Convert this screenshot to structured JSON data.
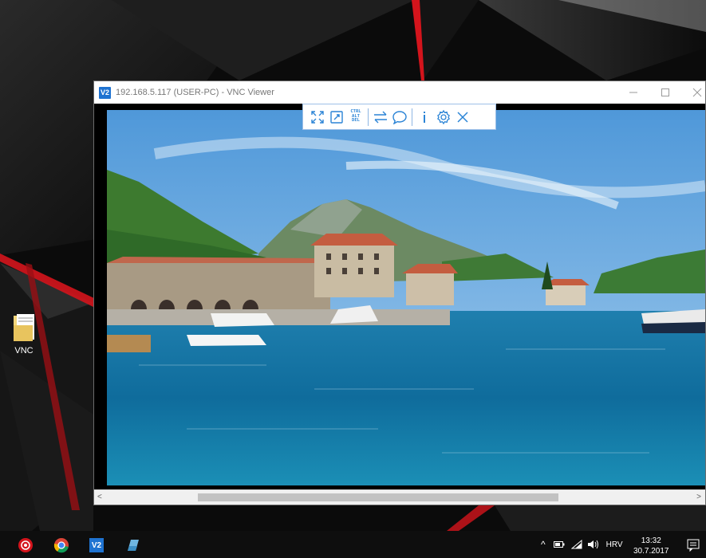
{
  "desktop": {
    "icons": [
      {
        "label": "VNC",
        "icon": "folder-icon"
      }
    ]
  },
  "vnc_window": {
    "title": "192.168.5.117 (USER-PC) - VNC Viewer",
    "app_icon_text": "V2",
    "controls": [
      "minimize-icon",
      "maximize-icon",
      "close-icon"
    ],
    "toolbar": {
      "buttons": [
        "fullscreen-icon",
        "scale-icon",
        "ctrl-alt-del-icon",
        "transfer-icon",
        "chat-icon",
        "info-icon",
        "settings-icon",
        "close-icon"
      ],
      "ctrl_alt_del": [
        "CTRL",
        "ALT",
        "DEL"
      ]
    },
    "scrollbar": {
      "left_arrow": "<",
      "right_arrow": ">"
    }
  },
  "taskbar": {
    "pinned": [
      "record-app-icon",
      "chrome-icon",
      "vnc-viewer-icon",
      "notes-app-icon"
    ],
    "vnc_icon_text": "V2",
    "tray": {
      "chevron": "^",
      "language": "HRV",
      "time": "13:32",
      "date": "30.7.2017"
    }
  },
  "colors": {
    "accent": "#1f73d1",
    "toolbar_icon": "#2b84d6",
    "wallpaper_red": "#d4141c"
  }
}
